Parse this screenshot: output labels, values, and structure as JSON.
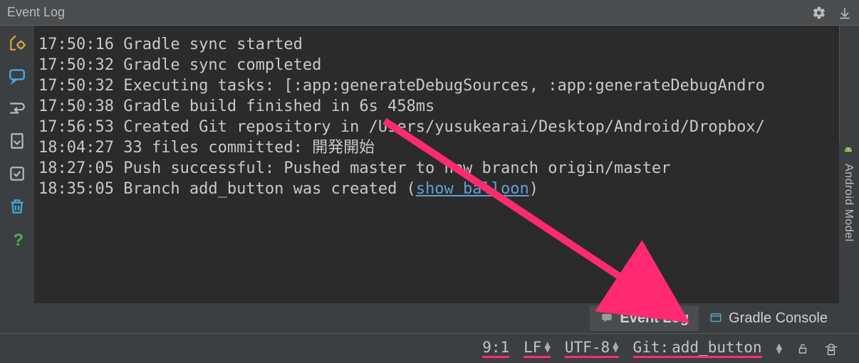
{
  "panel": {
    "title": "Event Log"
  },
  "log": {
    "lines": [
      "17:50:16 Gradle sync started",
      "17:50:32 Gradle sync completed",
      "17:50:32 Executing tasks: [:app:generateDebugSources, :app:generateDebugAndro",
      "17:50:38 Gradle build finished in 6s 458ms",
      "17:56:53 Created Git repository in /Users/yusukearai/Desktop/Android/Dropbox/",
      "18:04:27 33 files committed: 開発開始",
      "18:27:05 Push successful: Pushed master to new branch origin/master"
    ],
    "last": {
      "prefix": "18:35:05 Branch add_button was created (",
      "link": "show balloon",
      "suffix": ")"
    }
  },
  "right_panel": {
    "label": "Android Model"
  },
  "tabs": {
    "event_log": "Event Log",
    "gradle_console": "Gradle Console"
  },
  "status": {
    "pos": "9:1",
    "le": "LF",
    "enc": "UTF-8",
    "git_label": "Git:",
    "git_branch": "add_button"
  }
}
